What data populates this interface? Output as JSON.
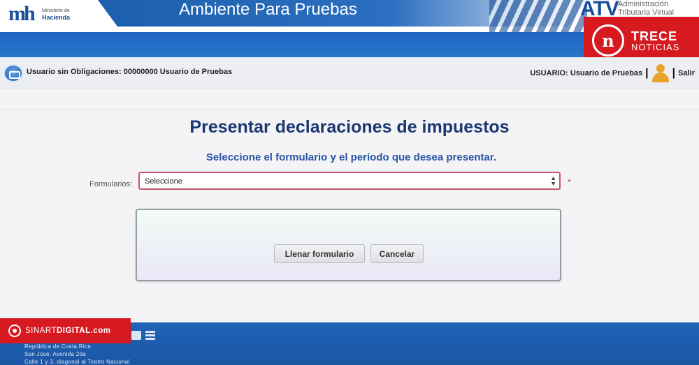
{
  "header": {
    "ministry_logo_mark": "mh",
    "ministry_logo_line1": "Ministerio de",
    "ministry_logo_line2": "Hacienda",
    "environment_title": "Ambiente Para  Pruebas",
    "atv_logo_mark": "ATV",
    "atv_line1": "Administración",
    "atv_line2": "Tributaria Virtual"
  },
  "overlay_badge": {
    "mark": "n",
    "line1": "TRECE",
    "line2": "NOTICIAS",
    "color": "#d71920"
  },
  "userbar": {
    "info": "Usuario sin Obligaciones: 00000000 Usuario de Pruebas",
    "user_label": "USUARIO: Usuario de Pruebas",
    "logout": "Salir"
  },
  "main": {
    "title": "Presentar declaraciones de impuestos",
    "subtitle": "Seleccione el formulario y el período que desea presentar.",
    "form_label": "Formularios:",
    "select_value": "Seleccione",
    "required_mark": "*",
    "fill_button": "Llenar formulario",
    "cancel_button": "Cancelar"
  },
  "footer": {
    "address_line1": "República de Costa Rica",
    "address_line2": "San José, Avenida 2da",
    "address_line3": "Calle 1 y 3, diagonal al Teatro Nacional",
    "icons": [
      "youtube-icon",
      "list-icon"
    ]
  },
  "watermark": {
    "name_prefix": "SINART",
    "name_suffix": "DIGITAL.com"
  },
  "colors": {
    "primary_blue": "#1e66c0",
    "title_navy": "#1c3872",
    "subtitle_blue": "#2a55a4",
    "select_border": "#c9566a",
    "brand_red": "#d71920"
  }
}
